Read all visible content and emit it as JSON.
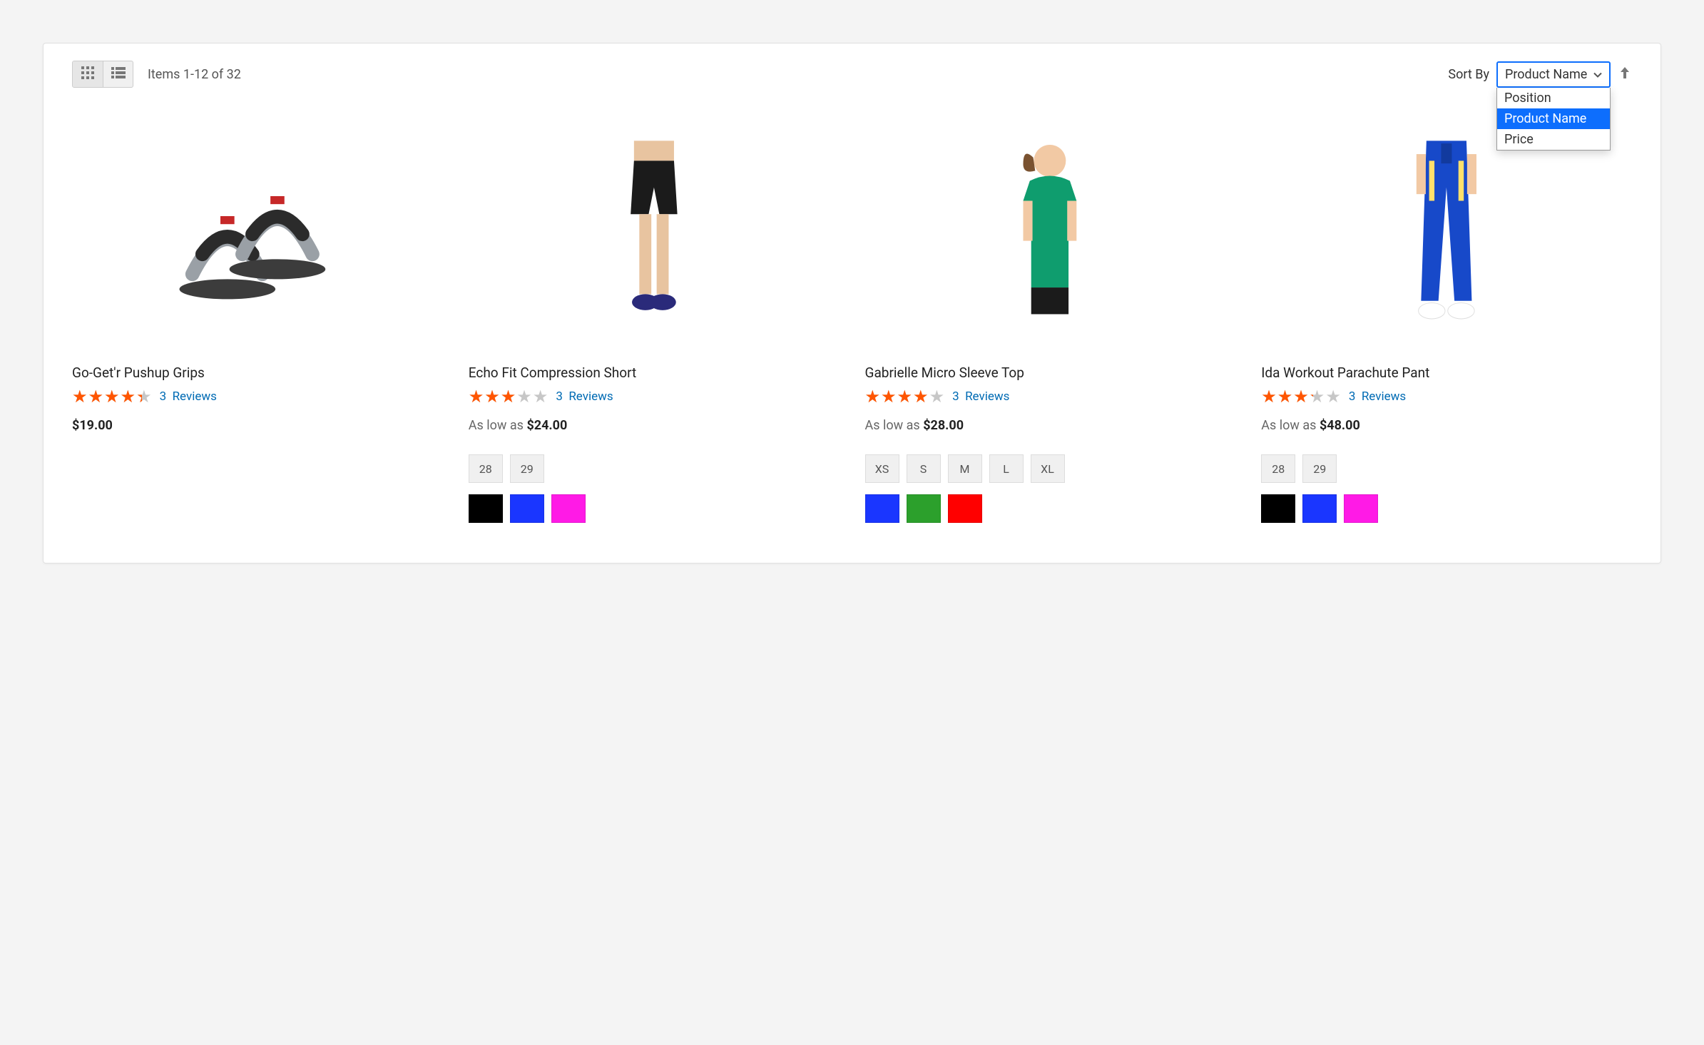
{
  "toolbar": {
    "item_count_text": "Items 1-12 of 32",
    "sort_label": "Sort By",
    "sort_selected": "Product Name",
    "sort_options": {
      "opt0": "Position",
      "opt1": "Product Name",
      "opt2": "Price"
    }
  },
  "products": {
    "p0": {
      "name": "Go-Get'r Pushup Grips",
      "rating_pct": "87",
      "review_count": "3",
      "reviews_label": "Reviews",
      "price": "$19.00",
      "as_low_as": "",
      "sizes": [],
      "colors": []
    },
    "p1": {
      "name": "Echo Fit Compression Short",
      "rating_pct": "60",
      "review_count": "3",
      "reviews_label": "Reviews",
      "price": "$24.00",
      "as_low_as": "As low as",
      "sizes": {
        "s0": "28",
        "s1": "29"
      },
      "colors": {
        "c0": "#000000",
        "c1": "#1a36ff",
        "c2": "#ff1ae6"
      }
    },
    "p2": {
      "name": "Gabrielle Micro Sleeve Top",
      "rating_pct": "80",
      "review_count": "3",
      "reviews_label": "Reviews",
      "price": "$28.00",
      "as_low_as": "As low as",
      "sizes": {
        "s0": "XS",
        "s1": "S",
        "s2": "M",
        "s3": "L",
        "s4": "XL"
      },
      "colors": {
        "c0": "#1a36ff",
        "c1": "#2ca02c",
        "c2": "#ff0000"
      }
    },
    "p3": {
      "name": "Ida Workout Parachute Pant",
      "rating_pct": "65",
      "review_count": "3",
      "reviews_label": "Reviews",
      "price": "$48.00",
      "as_low_as": "As low as",
      "sizes": {
        "s0": "28",
        "s1": "29"
      },
      "colors": {
        "c0": "#000000",
        "c1": "#1a36ff",
        "c2": "#ff1ae6"
      }
    }
  }
}
